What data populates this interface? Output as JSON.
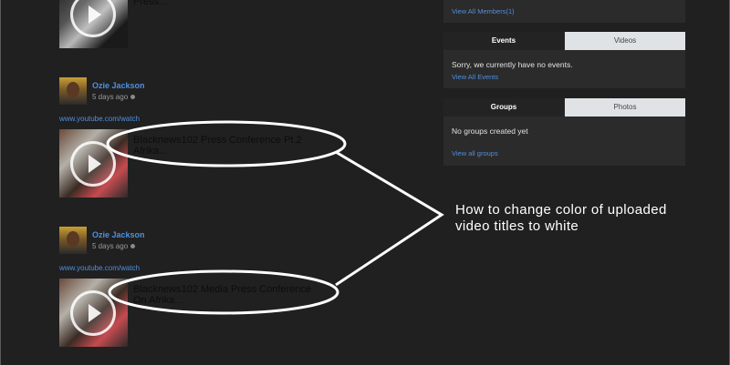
{
  "stream": {
    "top_item": {
      "title": "Press..."
    },
    "items": [
      {
        "author": "Ozie Jackson",
        "time_ago": "5 days ago",
        "link": "www.youtube.com/watch",
        "video_title": "Blacknews102 Press Conference Pt.2 Afrika..."
      },
      {
        "author": "Ozie Jackson",
        "time_ago": "5 days ago",
        "link": "www.youtube.com/watch",
        "video_title": "Blacknews102 Media Press Conference On Afrika..."
      }
    ]
  },
  "members": {
    "view_all_label": "View All Members(1)"
  },
  "events_widget": {
    "tab_events": "Events",
    "tab_videos": "Videos",
    "message": "Sorry, we currently have no events.",
    "link": "View All Events"
  },
  "groups_widget": {
    "tab_groups": "Groups",
    "tab_photos": "Photos",
    "message": "No groups created yet",
    "link": "View all groups"
  },
  "annotation": {
    "text_line1": "How to change color of uploaded",
    "text_line2": "video  titles to white",
    "color": "#ffffff"
  },
  "colors": {
    "background": "#202020",
    "link": "#4f8fe0",
    "panel": "#2b2b2b",
    "inactive_tab": "#dfe3e5"
  }
}
